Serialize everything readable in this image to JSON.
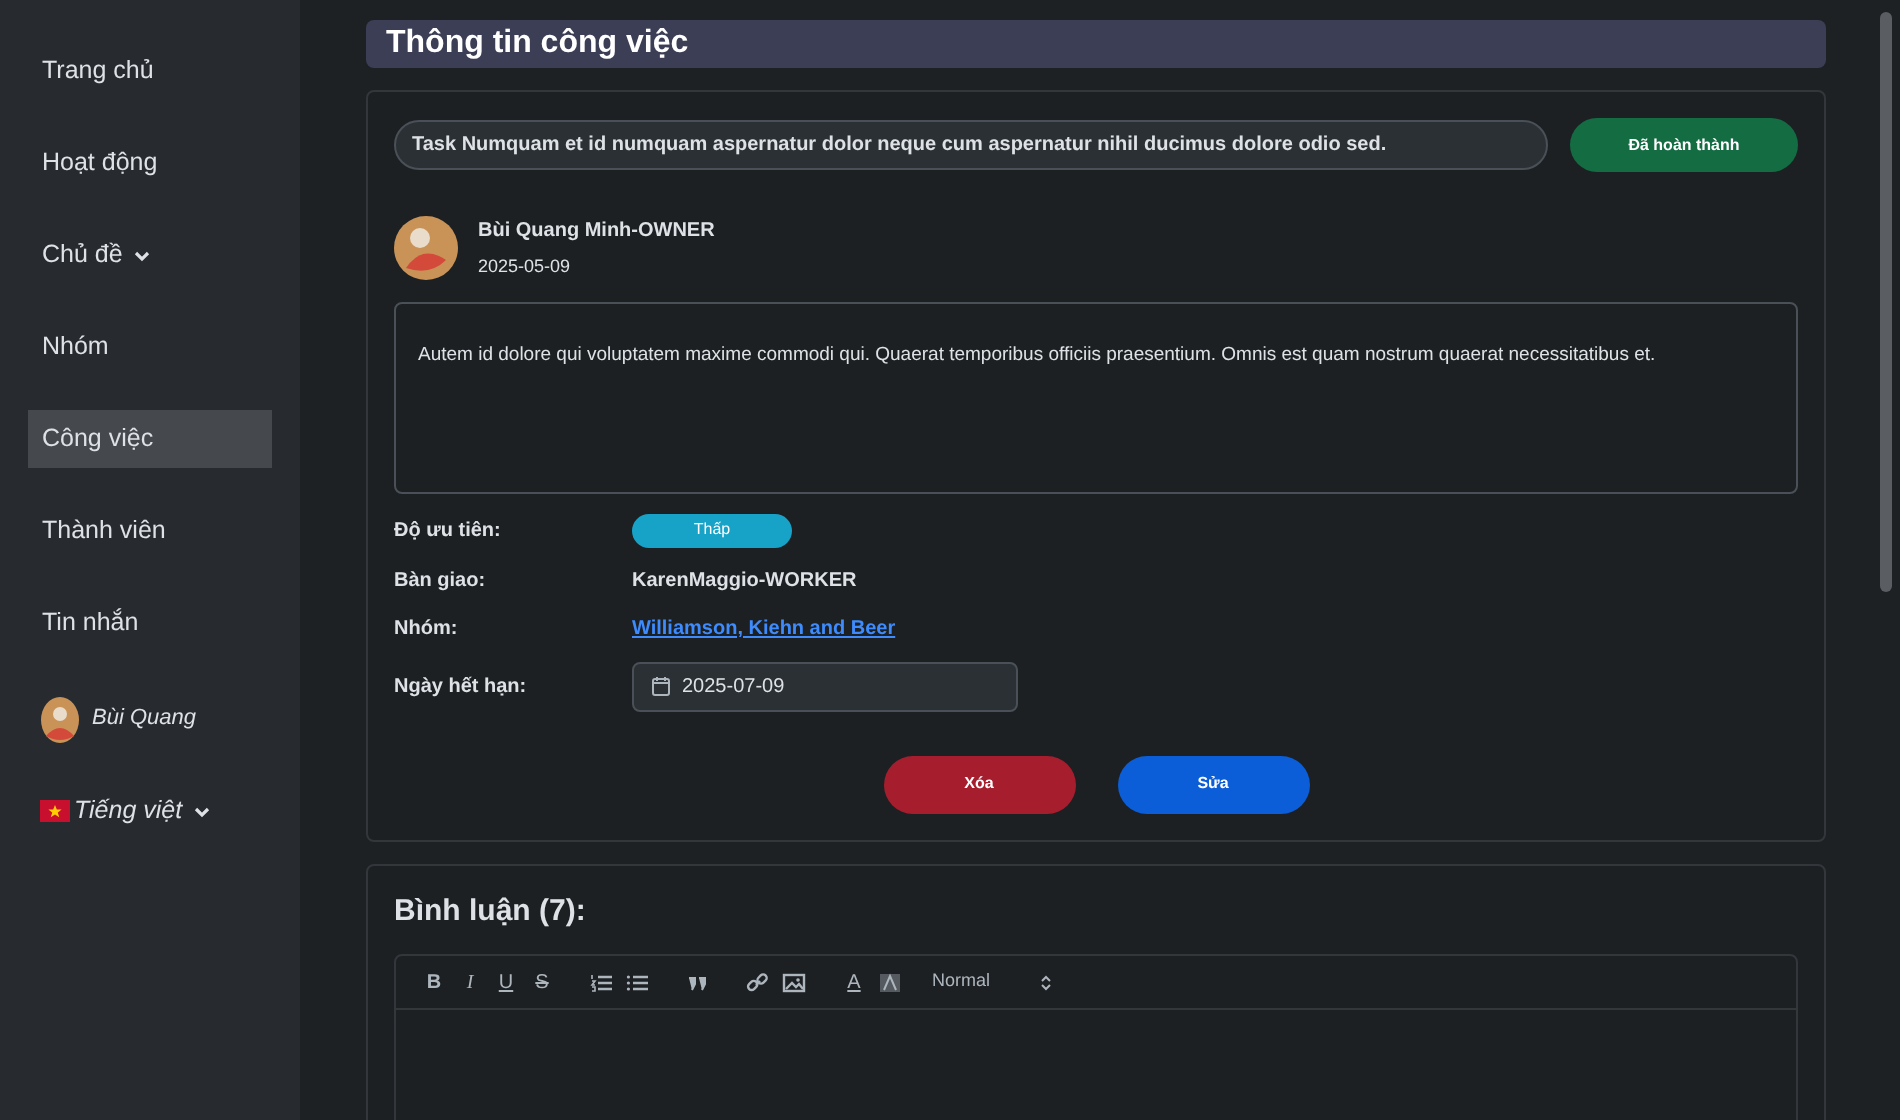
{
  "sidebar": {
    "items": [
      {
        "label": "Trang chủ",
        "selected": false,
        "has_caret": false
      },
      {
        "label": "Hoạt động",
        "selected": false,
        "has_caret": false
      },
      {
        "label": "Chủ đề",
        "selected": false,
        "has_caret": true
      },
      {
        "label": "Nhóm",
        "selected": false,
        "has_caret": false
      },
      {
        "label": "Công việc",
        "selected": true,
        "has_caret": false
      },
      {
        "label": "Thành viên",
        "selected": false,
        "has_caret": false
      },
      {
        "label": "Tin nhắn",
        "selected": false,
        "has_caret": false
      }
    ],
    "user": {
      "name": "Bùi Quang"
    },
    "language": {
      "label": "Tiếng việt"
    }
  },
  "header": {
    "title": "Thông tin công việc"
  },
  "task": {
    "title": "Task Numquam et id numquam aspernatur dolor neque cum aspernatur nihil ducimus dolore odio sed.",
    "status_button": "Đã hoàn thành",
    "owner": {
      "name": "Bùi Quang Minh-OWNER",
      "date": "2025-05-09"
    },
    "description": "Autem id dolore qui voluptatem maxime commodi qui. Quaerat temporibus officiis praesentium. Omnis est quam nostrum quaerat necessitatibus et.",
    "fields": [
      {
        "kind": "badge",
        "label": "Độ ưu tiên:",
        "value": "Thấp"
      },
      {
        "kind": "text",
        "label": "Bàn giao:",
        "value": "KarenMaggio-WORKER"
      },
      {
        "kind": "link",
        "label": "Nhóm:",
        "value": "Williamson, Kiehn and Beer"
      },
      {
        "kind": "date",
        "label": "Ngày hết hạn:",
        "value": "2025-07-09"
      }
    ],
    "buttons": [
      {
        "kind": "danger",
        "label": "Xóa"
      },
      {
        "kind": "primary",
        "label": "Sửa"
      }
    ]
  },
  "comments": {
    "title": "Bình luận (7):",
    "toolbar": [
      {
        "kind": "bold",
        "label": "B"
      },
      {
        "kind": "italic",
        "label": "I"
      },
      {
        "kind": "underline",
        "label": "U"
      },
      {
        "kind": "strike",
        "label": "S"
      },
      {
        "kind": "ordered-list"
      },
      {
        "kind": "bullet-list"
      },
      {
        "kind": "quote"
      },
      {
        "kind": "link"
      },
      {
        "kind": "image"
      },
      {
        "kind": "color",
        "label": "A"
      },
      {
        "kind": "background"
      }
    ],
    "format": "Normal"
  }
}
